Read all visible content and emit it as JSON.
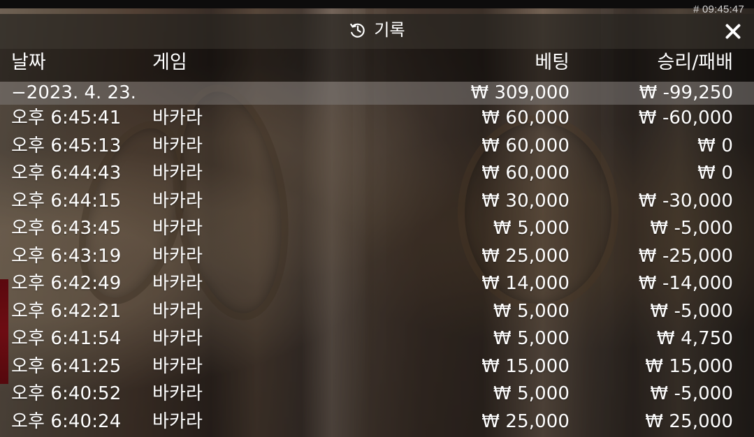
{
  "session_label": "# 09:45:47",
  "history": {
    "title": "기록",
    "icons": {
      "title": "history-icon",
      "close": "close-icon"
    },
    "columns": {
      "date": "날짜",
      "game": "게임",
      "bet": "베팅",
      "result": "승리/패배"
    },
    "summary": {
      "date": "−2023. 4. 23.",
      "game": "",
      "bet": "₩ 309,000",
      "result": "₩ -99,250"
    },
    "rows": [
      {
        "time": "오후 6:45:41",
        "game": "바카라",
        "bet": "₩ 60,000",
        "result": "₩ -60,000"
      },
      {
        "time": "오후 6:45:13",
        "game": "바카라",
        "bet": "₩ 60,000",
        "result": "₩ 0"
      },
      {
        "time": "오후 6:44:43",
        "game": "바카라",
        "bet": "₩ 60,000",
        "result": "₩ 0"
      },
      {
        "time": "오후 6:44:15",
        "game": "바카라",
        "bet": "₩ 30,000",
        "result": "₩ -30,000"
      },
      {
        "time": "오후 6:43:45",
        "game": "바카라",
        "bet": "₩ 5,000",
        "result": "₩ -5,000"
      },
      {
        "time": "오후 6:43:19",
        "game": "바카라",
        "bet": "₩ 25,000",
        "result": "₩ -25,000"
      },
      {
        "time": "오후 6:42:49",
        "game": "바카라",
        "bet": "₩ 14,000",
        "result": "₩ -14,000"
      },
      {
        "time": "오후 6:42:21",
        "game": "바카라",
        "bet": "₩ 5,000",
        "result": "₩ -5,000"
      },
      {
        "time": "오후 6:41:54",
        "game": "바카라",
        "bet": "₩ 5,000",
        "result": "₩ 4,750"
      },
      {
        "time": "오후 6:41:25",
        "game": "바카라",
        "bet": "₩ 15,000",
        "result": "₩ 15,000"
      },
      {
        "time": "오후 6:40:52",
        "game": "바카라",
        "bet": "₩ 5,000",
        "result": "₩ -5,000"
      },
      {
        "time": "오후 6:40:24",
        "game": "바카라",
        "bet": "₩ 25,000",
        "result": "₩ 25,000"
      }
    ]
  }
}
